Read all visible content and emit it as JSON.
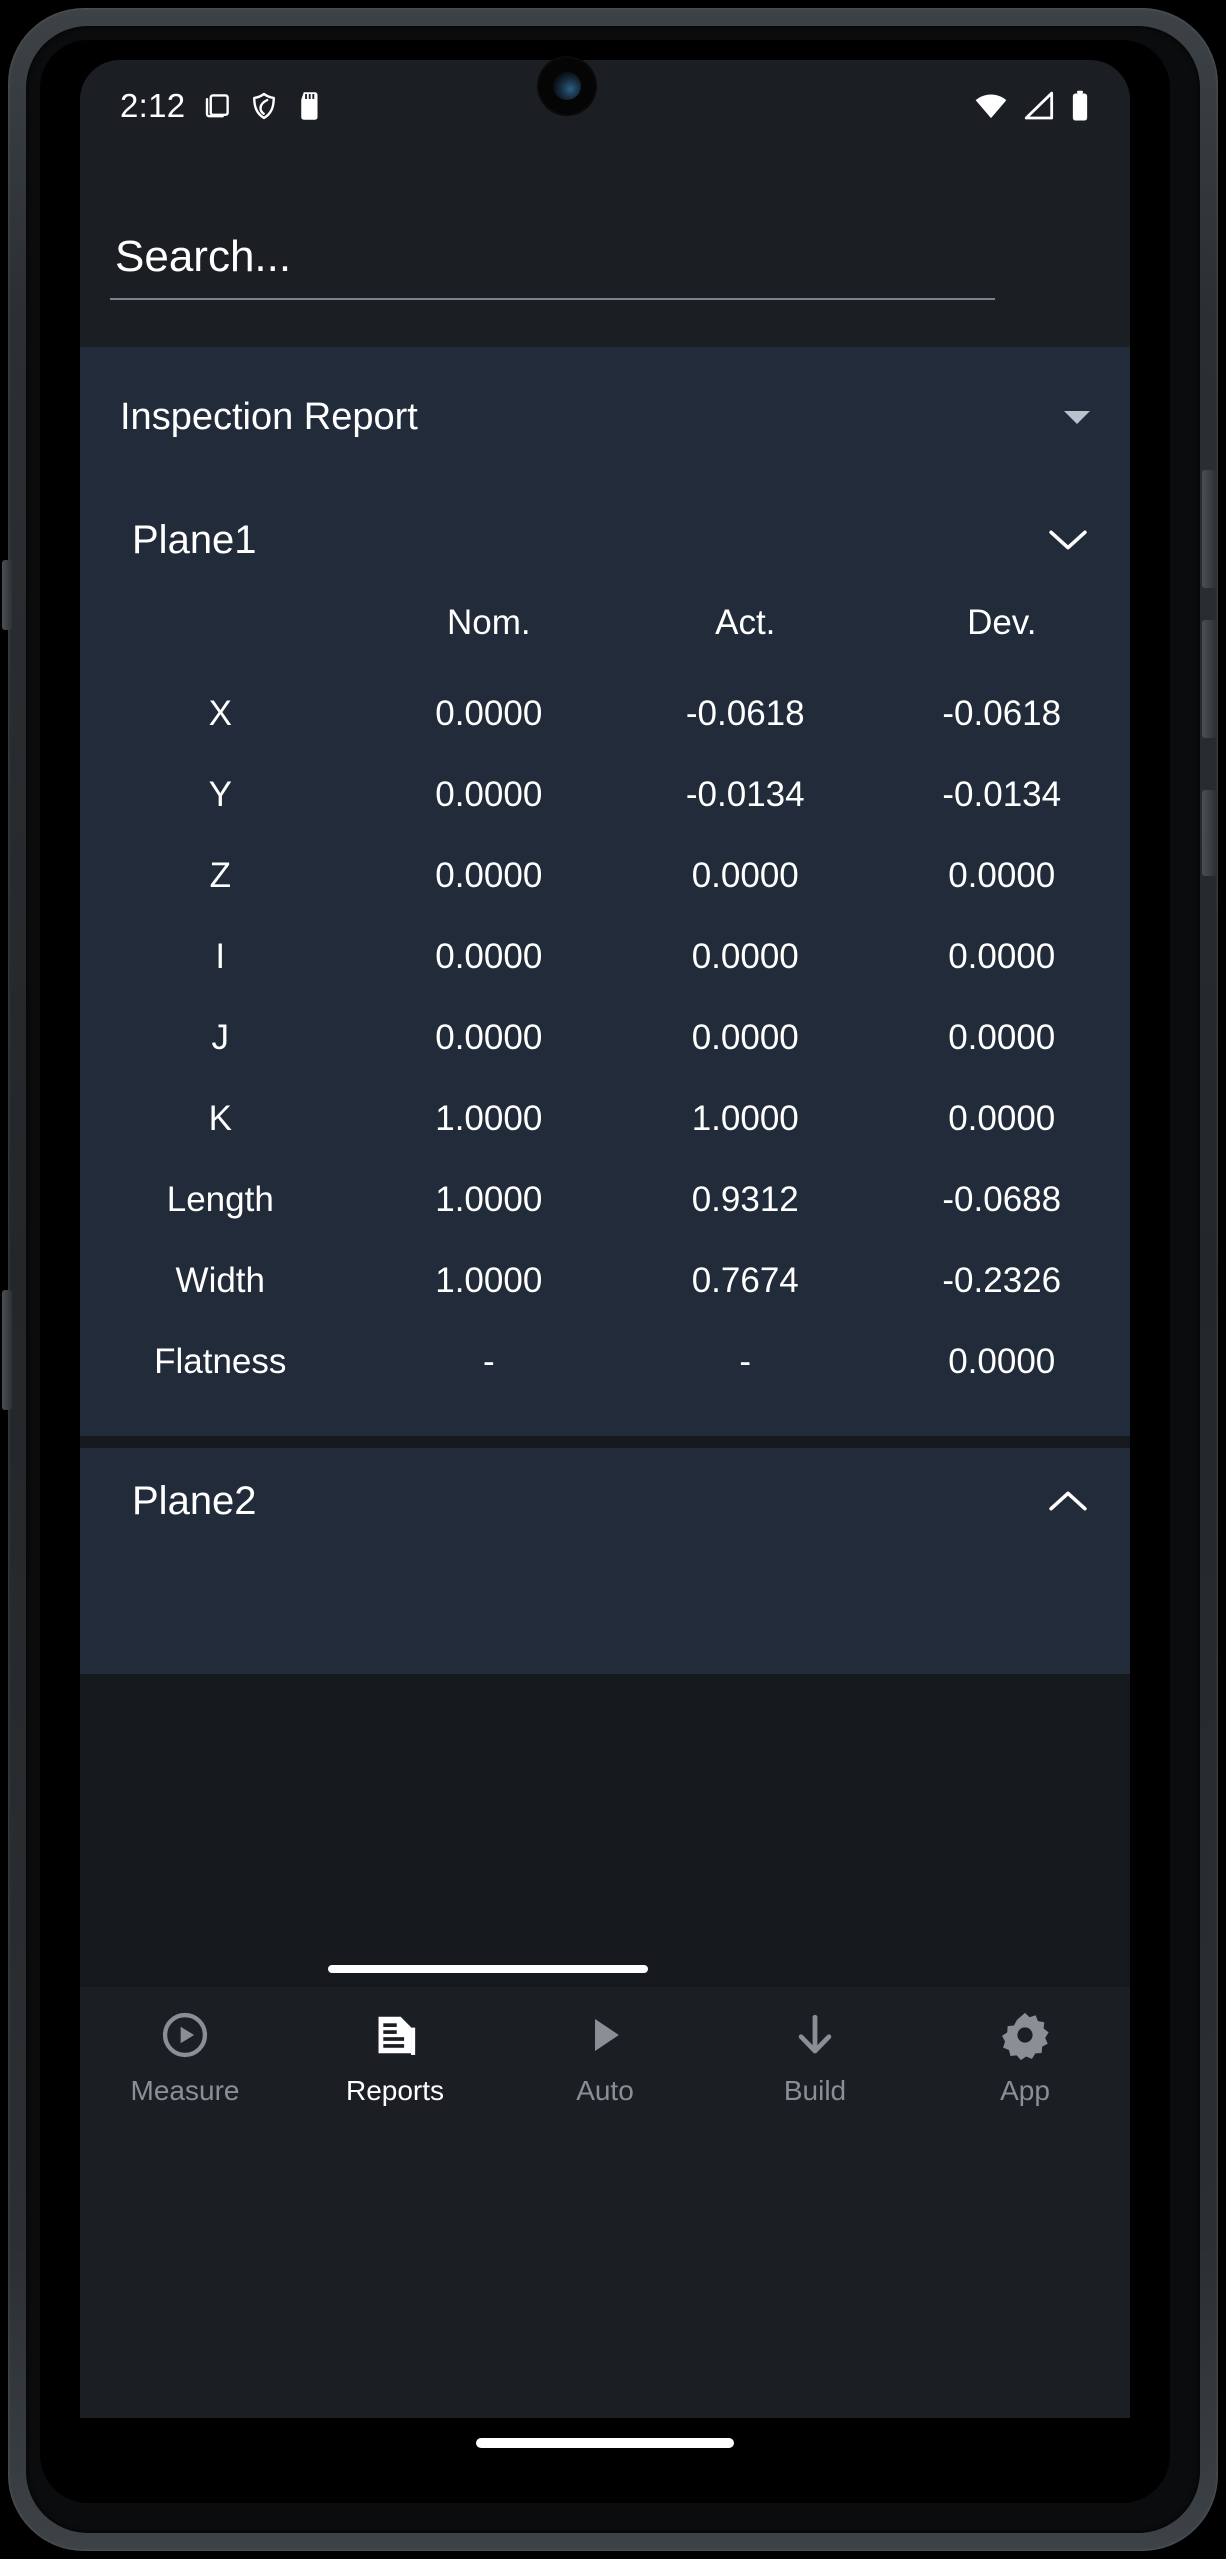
{
  "status_bar": {
    "time": "2:12",
    "left_icons": [
      "multi-window-icon",
      "shield-icon",
      "sd-card-icon"
    ],
    "right_icons": [
      "wifi-icon",
      "cellular-signal-icon",
      "battery-icon"
    ]
  },
  "search": {
    "placeholder": "Search...",
    "value": ""
  },
  "report_selector": {
    "selected": "Inspection Report",
    "icon": "chevron-down-icon"
  },
  "table_headers": {
    "label": "",
    "nominal": "Nom.",
    "actual": "Act.",
    "deviation": "Dev."
  },
  "sections": [
    {
      "title": "Plane1",
      "expanded": true,
      "chevron": "chevron-down-icon",
      "rows": [
        {
          "label": "X",
          "nom": "0.0000",
          "act": "-0.0618",
          "dev": "-0.0618"
        },
        {
          "label": "Y",
          "nom": "0.0000",
          "act": "-0.0134",
          "dev": "-0.0134"
        },
        {
          "label": "Z",
          "nom": "0.0000",
          "act": "0.0000",
          "dev": "0.0000"
        },
        {
          "label": "I",
          "nom": "0.0000",
          "act": "0.0000",
          "dev": "0.0000"
        },
        {
          "label": "J",
          "nom": "0.0000",
          "act": "0.0000",
          "dev": "0.0000"
        },
        {
          "label": "K",
          "nom": "1.0000",
          "act": "1.0000",
          "dev": "0.0000"
        },
        {
          "label": "Length",
          "nom": "1.0000",
          "act": "0.9312",
          "dev": "-0.0688"
        },
        {
          "label": "Width",
          "nom": "1.0000",
          "act": "0.7674",
          "dev": "-0.2326"
        },
        {
          "label": "Flatness",
          "nom": "-",
          "act": "-",
          "dev": "0.0000"
        }
      ]
    },
    {
      "title": "Plane2",
      "expanded": false,
      "chevron": "chevron-up-icon",
      "rows": []
    }
  ],
  "bottom_nav": {
    "active_index": 1,
    "items": [
      {
        "label": "Measure",
        "icon": "play-circle-icon"
      },
      {
        "label": "Reports",
        "icon": "report-document-icon"
      },
      {
        "label": "Auto",
        "icon": "play-triangle-icon"
      },
      {
        "label": "Build",
        "icon": "arrow-down-icon"
      },
      {
        "label": "App",
        "icon": "gear-icon"
      }
    ]
  },
  "colors": {
    "app_background": "#1b1f24",
    "card_background": "#222b39",
    "gap_background": "#15181d",
    "text_primary": "#ffffff",
    "text_inactive": "#8b8f95"
  }
}
